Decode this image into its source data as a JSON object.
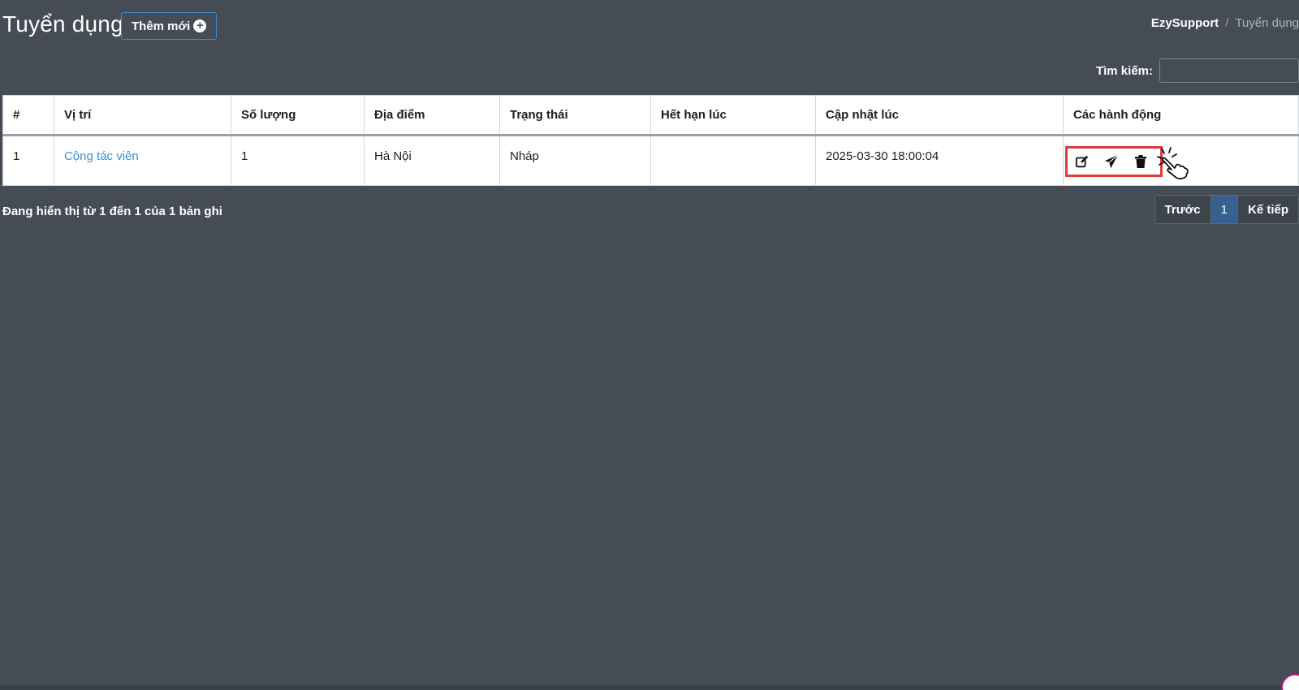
{
  "header": {
    "title": "Tuyển dụng",
    "add_button_label": "Thêm mới",
    "add_button_icon": "plus-circle-icon"
  },
  "breadcrumb": {
    "home": "EzySupport",
    "separator": "/",
    "current": "Tuyển dụng"
  },
  "search": {
    "label": "Tìm kiếm:",
    "value": "",
    "placeholder": ""
  },
  "table": {
    "columns": [
      "#",
      "Vị trí",
      "Số lượng",
      "Địa điểm",
      "Trạng thái",
      "Hết hạn lúc",
      "Cập nhật lúc",
      "Các hành động"
    ],
    "rows": [
      {
        "index": "1",
        "position": "Cộng tác viên",
        "quantity": "1",
        "location": "Hà Nội",
        "status": "Nháp",
        "expires_at": "",
        "updated_at": "2025-03-30 18:00:04",
        "actions": [
          "edit-icon",
          "send-icon",
          "trash-icon"
        ]
      }
    ]
  },
  "footer": {
    "info": "Đang hiển thị từ 1 đến 1 của 1 bản ghi"
  },
  "pagination": {
    "prev_label": "Trước",
    "current_page": "1",
    "next_label": "Kế tiếp"
  },
  "colors": {
    "background": "#454c55",
    "link": "#3a8fd6",
    "highlight": "#e23b3b",
    "active_page": "#35608f"
  }
}
